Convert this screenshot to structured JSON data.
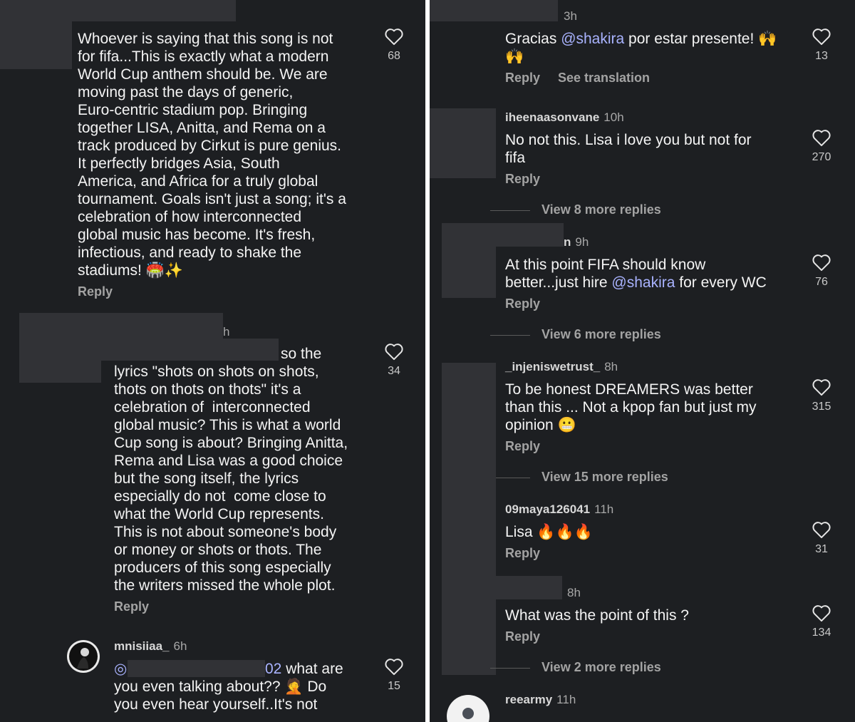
{
  "left": {
    "c1": {
      "lines": [
        "Whoever is saying that this song is not",
        "for fifa...This is exactly what a modern",
        "World Cup anthem should be. We are",
        "moving past the days of generic,",
        "Euro-centric stadium pop. Bringing",
        "together LISA, Anitta, and Rema on a",
        "track produced by Cirkut is pure genius.",
        "It perfectly bridges Asia, South",
        "America, and Africa for a truly global",
        "tournament. Goals isn't just a song; it's a",
        "celebration of how interconnected",
        "global music has become. It's fresh,",
        "infectious, and ready to shake the",
        "stadiums! 🏟️✨"
      ],
      "likes": "68",
      "reply": "Reply"
    },
    "c2": {
      "time": "h",
      "first_line": "so the",
      "lines": [
        "lyrics \"shots on shots on shots,",
        "thots on thots on thots\" it's a",
        "celebration of  interconnected",
        "global music? This is what a world",
        "Cup song is about? Bringing Anitta,",
        "Rema and Lisa was a good choice",
        "but the song itself, the lyrics",
        "especially do not  come close to",
        "what the World Cup represents.",
        "This is not about someone's body",
        "or money or shots or thots. The",
        "producers of this song especially",
        "the writers missed the whole plot."
      ],
      "likes": "34",
      "reply": "Reply"
    },
    "c3": {
      "username": "mnisiiaa_",
      "time": "6h",
      "mention_tail": "02",
      "line1_rest": " what are",
      "line2": "you even talking about?? 🤦 Do",
      "line3": "you even hear yourself..It's not",
      "likes": "15"
    }
  },
  "right": {
    "r1": {
      "time": "3h",
      "prefix": "Gracias ",
      "mention": "@shakira",
      "suffix": " por estar presente! 🙌",
      "line2": "🙌",
      "likes": "13",
      "reply": "Reply",
      "translate": "See translation"
    },
    "r2": {
      "username": "iheenaasonvane",
      "time": "10h",
      "line1": "No not this. Lisa i love you but not for",
      "line2": "fifa",
      "likes": "270",
      "reply": "Reply",
      "view_more": "View 8 more replies"
    },
    "r3": {
      "username": "n",
      "time": "9h",
      "line1": "At this point FIFA should know",
      "line2_prefix": "better...just hire ",
      "mention": "@shakira",
      "line2_suffix": " for every WC",
      "likes": "76",
      "reply": "Reply",
      "view_more": "View 6 more replies"
    },
    "r4": {
      "username": "_injeniswetrust_",
      "time": "8h",
      "line1": "To be honest DREAMERS was better",
      "line2": "than this ... Not a kpop fan but just my",
      "line3": "opinion 😬",
      "likes": "315",
      "reply": "Reply",
      "view_more": "View 15 more replies"
    },
    "r5": {
      "username": "09maya126041",
      "time": "11h",
      "line1": "Lisa 🔥🔥🔥",
      "likes": "31",
      "reply": "Reply"
    },
    "r6": {
      "time": "8h",
      "line1": "What was the point of this ?",
      "likes": "134",
      "reply": "Reply",
      "view_more": "View 2 more replies"
    },
    "r7": {
      "username": "reearmy",
      "time": "11h"
    }
  }
}
